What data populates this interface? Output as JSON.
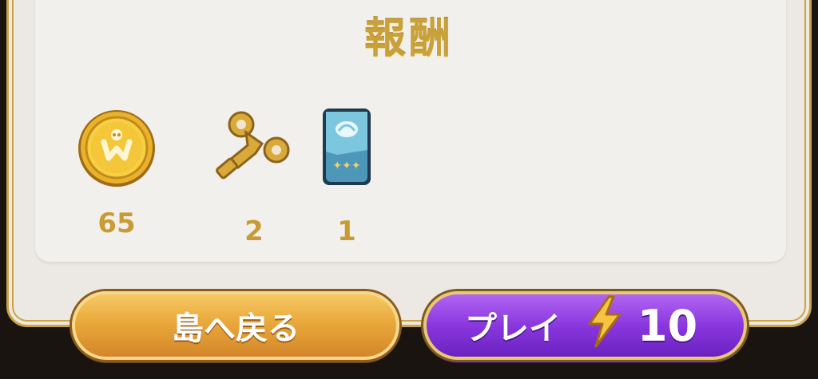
{
  "title": "報酬",
  "rewards": [
    {
      "icon": "gold-coin-icon",
      "count": "65"
    },
    {
      "icon": "wind-up-key-icon",
      "count": "2"
    },
    {
      "icon": "card-pack-icon",
      "count": "1"
    }
  ],
  "buttons": {
    "back_label": "島へ戻る",
    "play_label": "プレイ",
    "energy_cost": "10"
  },
  "colors": {
    "gold": "#c9a13b",
    "back_button": "#e9a83a",
    "play_button": "#8a37de"
  }
}
